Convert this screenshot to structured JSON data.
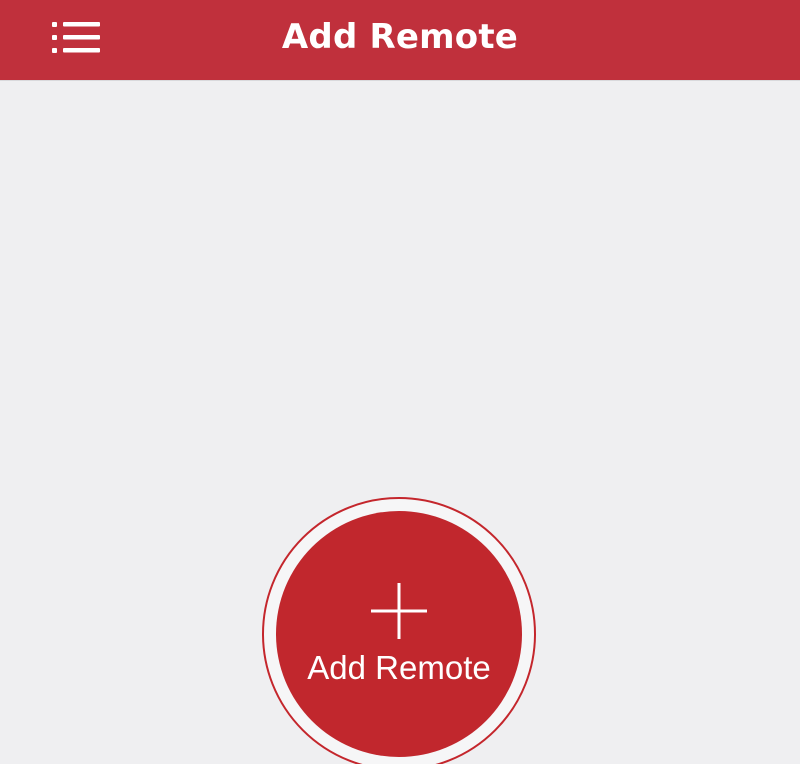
{
  "header": {
    "title": "Add Remote",
    "menu_icon": "list-menu-icon",
    "background_color": "#c0303c"
  },
  "fab": {
    "label": "Add Remote",
    "icon": "plus-icon",
    "color": "#c1272d"
  },
  "colors": {
    "page_background": "#efeff1",
    "text_on_accent": "#ffffff"
  }
}
